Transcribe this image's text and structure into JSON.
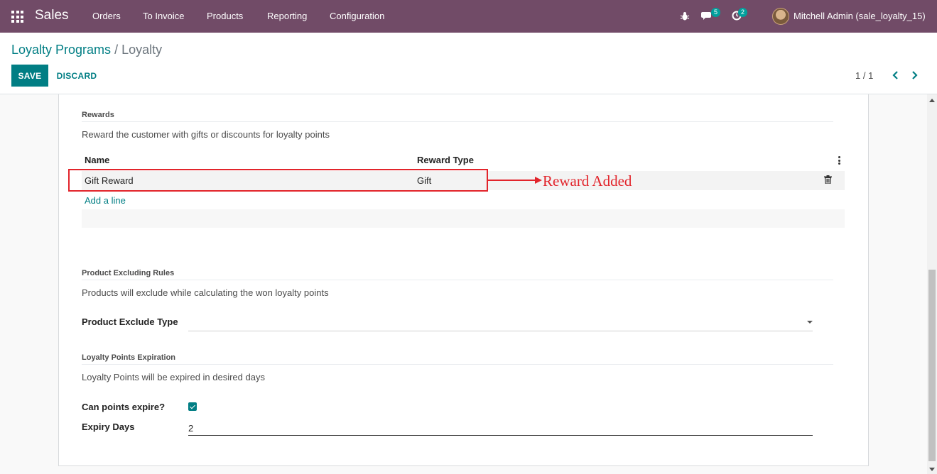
{
  "navbar": {
    "brand": "Sales",
    "menu": [
      "Orders",
      "To Invoice",
      "Products",
      "Reporting",
      "Configuration"
    ],
    "messages_count": "5",
    "activities_count": "2",
    "user": "Mitchell Admin (sale_loyalty_15)"
  },
  "breadcrumb": {
    "parent": "Loyalty Programs",
    "separator": "/",
    "current": "Loyalty"
  },
  "actions": {
    "save": "SAVE",
    "discard": "DISCARD"
  },
  "pager": {
    "value": "1 / 1"
  },
  "rewards": {
    "title": "Rewards",
    "description": "Reward the customer with gifts or discounts for loyalty points",
    "columns": [
      "Name",
      "Reward Type"
    ],
    "rows": [
      {
        "name": "Gift Reward",
        "type": "Gift"
      }
    ],
    "add_line": "Add a line"
  },
  "annotation": {
    "text": "Reward Added",
    "color": "#e2242b"
  },
  "exclusion": {
    "title": "Product Excluding Rules",
    "description": "Products will exclude while calculating the won loyalty points",
    "field_label": "Product Exclude Type",
    "field_value": ""
  },
  "expiration": {
    "title": "Loyalty Points Expiration",
    "description": "Loyalty Points will be expired in desired days",
    "can_expire_label": "Can points expire?",
    "can_expire": true,
    "expiry_days_label": "Expiry Days",
    "expiry_days": "2"
  },
  "colors": {
    "navbar": "#714b67",
    "accent": "#017e84",
    "badge": "#00a09d"
  }
}
